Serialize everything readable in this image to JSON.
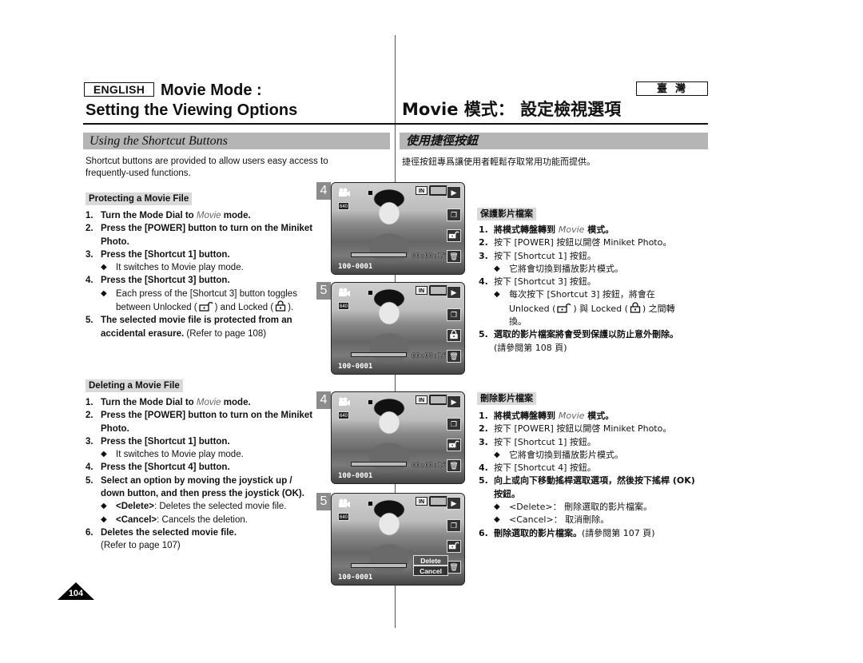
{
  "header": {
    "lang_en": "ENGLISH",
    "lang_tw": "臺灣",
    "title_line1": "Movie Mode :",
    "title_line2": "Setting the Viewing Options",
    "title_zh": "Movie 模式： 設定檢視選項"
  },
  "section": {
    "title_en": "Using the Shortcut Buttons",
    "title_zh": "使用捷徑按鈕",
    "intro_en": "Shortcut buttons are provided to allow users easy access to frequently-used functions.",
    "intro_zh": "捷徑按鈕專爲讓使用者輕鬆存取常用功能而提供。"
  },
  "protect": {
    "heading_en": "Protecting a Movie File",
    "heading_zh": "保護影片檔案",
    "en": {
      "s1_pre": "Turn the Mode Dial to ",
      "s1_italic": "Movie",
      "s1_post": " mode.",
      "s2": "Press the [POWER] button to turn on the Miniket Photo.",
      "s3": "Press the [Shortcut 1] button.",
      "s3_b": "It switches to Movie play mode.",
      "s4": "Press the [Shortcut 3] button.",
      "s4_b_pre": "Each press of the [Shortcut 3] button toggles between Unlocked (",
      "s4_b_mid": ") and Locked (",
      "s4_b_post": ").",
      "s5": "The selected movie file is protected from an accidental erasure.",
      "s5_ref": " (Refer to page 108)"
    },
    "zh": {
      "s1_pre": "將模式轉盤轉到 ",
      "s1_italic": "Movie",
      "s1_post": " 模式。",
      "s2": "按下 [POWER] 按鈕以開啓 Miniket Photo。",
      "s3": "按下 [Shortcut 1] 按鈕。",
      "s3_b": "它將會切換到播放影片模式。",
      "s4": "按下 [Shortcut 3] 按鈕。",
      "s4_b_pre": "每次按下 [Shortcut 3] 按鈕，將會在 Unlocked (",
      "s4_b_mid": ") 與 Locked (",
      "s4_b_post": ") 之間轉換。",
      "s5": "選取的影片檔案將會受到保護以防止意外刪除。",
      "s5_ref": "(請參閱第 108 頁)"
    }
  },
  "delete": {
    "heading_en": "Deleting a Movie File",
    "heading_zh": "刪除影片檔案",
    "en": {
      "s1_pre": "Turn the Mode Dial to ",
      "s1_italic": "Movie",
      "s1_post": "  mode.",
      "s2": "Press the [POWER] button to turn on the Miniket Photo.",
      "s3": "Press the [Shortcut 1] button.",
      "s3_b": "It switches to Movie play mode.",
      "s4": "Press the [Shortcut 4] button.",
      "s5": "Select an option by moving the joystick up / down button, and then press the joystick (OK).",
      "s5_b1_key": "<Delete>",
      "s5_b1_txt": ": Deletes the selected movie file.",
      "s5_b2_key": "<Cancel>",
      "s5_b2_txt": ": Cancels the deletion.",
      "s6": "Deletes the selected movie file.",
      "s6_ref": "(Refer to page 107)"
    },
    "zh": {
      "s1_pre": "將模式轉盤轉到 ",
      "s1_italic": "Movie",
      "s1_post": " 模式。",
      "s2": "按下 [POWER] 按鈕以開啓 Miniket Photo。",
      "s3": "按下 [Shortcut 1] 按鈕。",
      "s3_b": "它將會切換到播放影片模式。",
      "s4": "按下 [Shortcut 4] 按鈕。",
      "s5": "向上或向下移動搖桿選取選項，然後按下搖桿 (OK) 按鈕。",
      "s5_b1_key": "<Delete>",
      "s5_b1_txt": "： 刪除選取的影片檔案。",
      "s5_b2_key": "<Cancel>",
      "s5_b2_txt": "： 取消刪除。",
      "s6": "刪除選取的影片檔案。",
      "s6_ref": "(請參閱第 107 頁)"
    }
  },
  "screens": [
    {
      "step": "4",
      "resolution": "640",
      "storage": "IN",
      "counter": "00:00:16",
      "file_id": "100-0001",
      "lock_state": "unlocked",
      "menu": null
    },
    {
      "step": "5",
      "resolution": "640",
      "storage": "IN",
      "counter": "00:00:16",
      "file_id": "100-0001",
      "lock_state": "locked",
      "menu": null
    },
    {
      "step": "4",
      "resolution": "640",
      "storage": "IN",
      "counter": "00:00:16",
      "file_id": "100-0001",
      "lock_state": "unlocked",
      "menu": null
    },
    {
      "step": "5",
      "resolution": "640",
      "storage": "IN",
      "counter": "00:00:16",
      "file_id": "100-0001",
      "lock_state": "unlocked",
      "menu": {
        "options": [
          "Delete",
          "Cancel"
        ],
        "selected": "Delete"
      }
    }
  ],
  "step_labels": {
    "n1": "1.",
    "n2": "2.",
    "n3": "3.",
    "n4": "4.",
    "n5": "5.",
    "n6": "6.",
    "bullet": "◆"
  },
  "icons": {
    "unlocked": "unlocked-icon",
    "locked": "locked-icon",
    "play": "play-icon",
    "trash": "trash-icon",
    "camcorder": "camcorder-icon",
    "multi": "multi-view-icon"
  },
  "footer": {
    "page_number": "104"
  }
}
